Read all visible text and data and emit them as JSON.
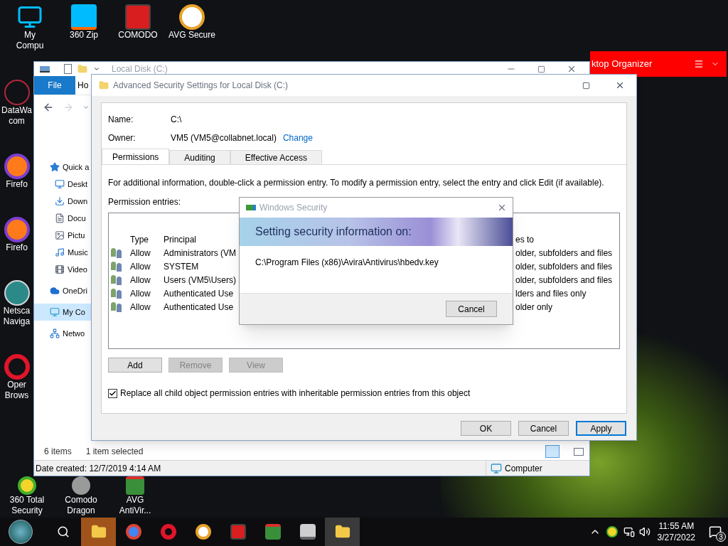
{
  "desktop_icons_top": [
    {
      "kind": "computer",
      "lines": [
        "My",
        "Compu"
      ]
    },
    {
      "kind": "zip",
      "lines": [
        "360 Zip"
      ]
    },
    {
      "kind": "comodo",
      "lines": [
        "COMODO"
      ]
    },
    {
      "kind": "avg-browser",
      "lines": [
        "AVG Secure"
      ]
    }
  ],
  "desktop_icons_left": [
    {
      "kind": "datawave",
      "lines": [
        "DataWa",
        "com"
      ]
    },
    {
      "kind": "firefox",
      "lines": [
        "Firefo"
      ]
    },
    {
      "kind": "firefox",
      "lines": [
        "Firefo"
      ]
    },
    {
      "kind": "netscape",
      "lines": [
        "Netsca",
        "Naviga"
      ]
    },
    {
      "kind": "opera",
      "lines": [
        "Oper",
        "Brows"
      ]
    }
  ],
  "desktop_icons_bottom": [
    {
      "kind": "totalsecurity",
      "lines": [
        "360 Total",
        "Security"
      ]
    },
    {
      "kind": "dragon",
      "lines": [
        "Comodo",
        "Dragon"
      ]
    },
    {
      "kind": "avg",
      "lines": [
        "AVG",
        "AntiVir..."
      ]
    }
  ],
  "desktop_organizer": {
    "title": "ktop Organizer"
  },
  "explorer": {
    "title": "Local Disk (C:)",
    "ribbon_tabs": [
      {
        "label": "File",
        "selected": true
      },
      {
        "label": "Ho",
        "selected": false
      }
    ],
    "nav_items": [
      {
        "kind": "star",
        "label": "Quick a",
        "selected": false,
        "children": [
          {
            "kind": "desktop",
            "label": "Deskt",
            "selected": false
          },
          {
            "kind": "download",
            "label": "Down",
            "selected": false
          },
          {
            "kind": "document",
            "label": "Docu",
            "selected": false
          },
          {
            "kind": "picture",
            "label": "Pictu",
            "selected": false
          },
          {
            "kind": "music",
            "label": "Music",
            "selected": false
          },
          {
            "kind": "video",
            "label": "Video",
            "selected": false
          }
        ]
      },
      {
        "kind": "cloud",
        "label": "OneDri",
        "selected": false
      },
      {
        "kind": "computer",
        "label": "My Co",
        "selected": true
      },
      {
        "kind": "network",
        "label": "Netwo",
        "selected": false
      }
    ],
    "status": {
      "count": "6 items",
      "selection": "1 item selected"
    },
    "details": {
      "date": "Date created: 12/7/2019 4:14 AM",
      "location": "Computer"
    }
  },
  "security_dialog": {
    "title": "Advanced Security Settings for Local Disk (C:)",
    "name_label": "Name:",
    "name_value": "C:\\",
    "owner_label": "Owner:",
    "owner_value": "VM5 (VM5@collabnet.local)",
    "change_link": "Change",
    "tabs": [
      {
        "label": "Permissions",
        "selected": true
      },
      {
        "label": "Auditing",
        "selected": false
      },
      {
        "label": "Effective Access",
        "selected": false
      }
    ],
    "description": "For additional information, double-click a permission entry. To modify a permission entry, select the entry and click Edit (if available).",
    "entries_label": "Permission entries:",
    "columns": [
      "Type",
      "Principal",
      "es to"
    ],
    "entries": [
      {
        "type": "Allow",
        "principal": "Administrators (VM",
        "applies_to": "older, subfolders and files"
      },
      {
        "type": "Allow",
        "principal": "SYSTEM",
        "applies_to": "older, subfolders and files"
      },
      {
        "type": "Allow",
        "principal": "Users (VM5\\Users)",
        "applies_to": "older, subfolders and files"
      },
      {
        "type": "Allow",
        "principal": "Authenticated Use",
        "applies_to": "lders and files only"
      },
      {
        "type": "Allow",
        "principal": "Authenticated Use",
        "applies_to": "older only"
      }
    ],
    "list_buttons": [
      {
        "label": "Add",
        "disabled": false
      },
      {
        "label": "Remove",
        "disabled": true
      },
      {
        "label": "View",
        "disabled": true
      }
    ],
    "replace_checkbox": {
      "label": "Replace all child object permission entries with inheritable permission entries from this object",
      "checked": true
    },
    "buttons": [
      {
        "label": "OK",
        "default": false
      },
      {
        "label": "Cancel",
        "default": false
      },
      {
        "label": "Apply",
        "default": true
      }
    ]
  },
  "progress_dialog": {
    "title": "Windows Security",
    "heading": "Setting security information on:",
    "path": "C:\\Program Files (x86)\\Avira\\Antivirus\\hbedv.key",
    "button": "Cancel"
  },
  "taskbar": {
    "apps": [
      {
        "kind": "explorer",
        "active": true
      },
      {
        "kind": "chrome",
        "active": false
      },
      {
        "kind": "opera",
        "active": false
      },
      {
        "kind": "avg-browser",
        "active": false
      },
      {
        "kind": "comodo",
        "active": false
      },
      {
        "kind": "avg",
        "active": false
      },
      {
        "kind": "shredder",
        "active": false
      },
      {
        "kind": "folder",
        "active": true
      }
    ],
    "time": "11:55 AM",
    "date": "3/27/2022",
    "notifications": "3"
  }
}
